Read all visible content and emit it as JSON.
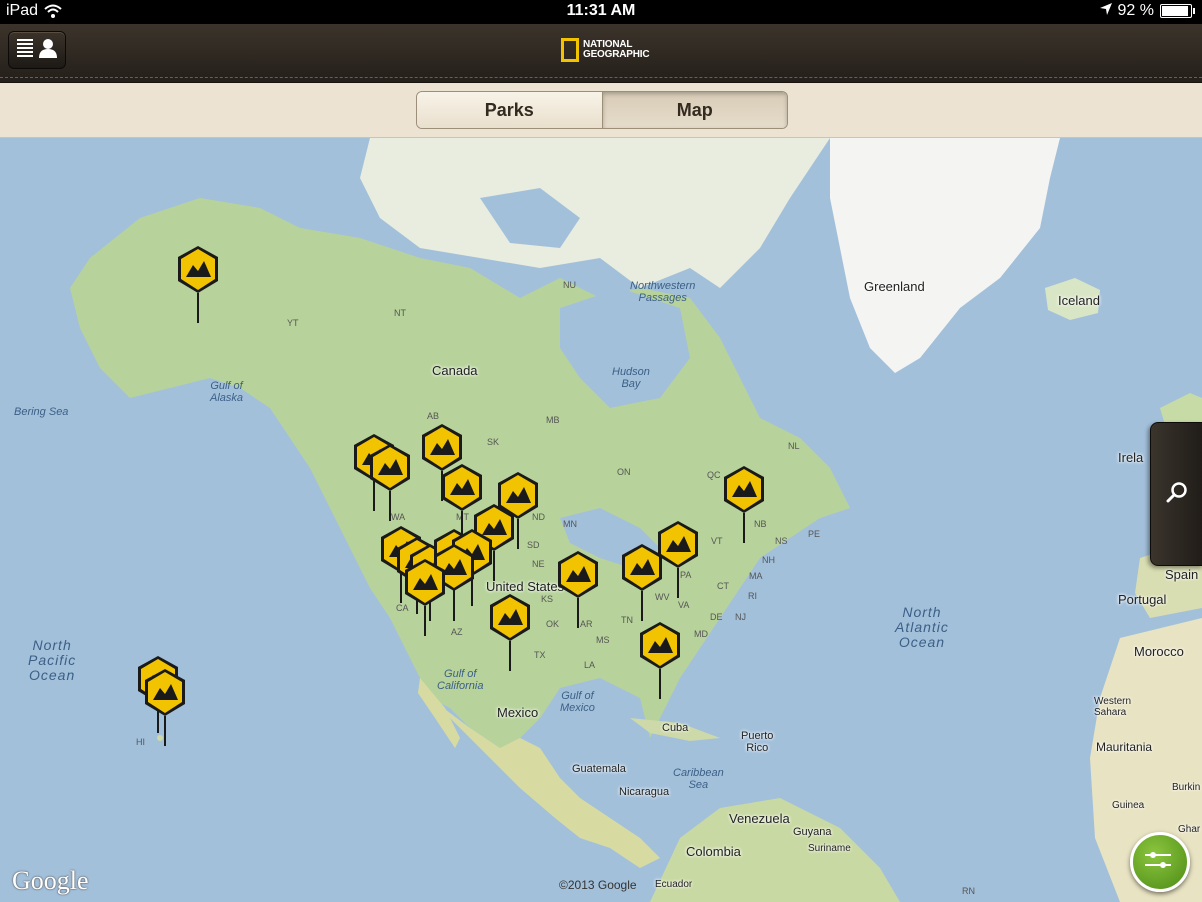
{
  "status_bar": {
    "device": "iPad",
    "time": "11:31 AM",
    "battery": "92 %",
    "battery_level": 0.92
  },
  "nav": {
    "menu_icon": "list-profile-icon",
    "logo_line1": "NATIONAL",
    "logo_line2": "GEOGRAPHIC"
  },
  "segments": {
    "parks": "Parks",
    "map": "Map",
    "selected": "Map"
  },
  "map": {
    "countries": {
      "canada": "Canada",
      "greenland": "Greenland",
      "iceland": "Iceland",
      "us": "United States",
      "mexico": "Mexico",
      "cuba": "Cuba",
      "puerto_rico": "Puerto\nRico",
      "guatemala": "Guatemala",
      "nicaragua": "Nicaragua",
      "venezuela": "Venezuela",
      "guyana": "Guyana",
      "suriname": "Suriname",
      "colombia": "Colombia",
      "ecuador": "Ecuador",
      "spain": "Spain",
      "portugal": "Portugal",
      "morocco": "Morocco",
      "western_sahara": "Western\nSahara",
      "mauritania": "Mauritania",
      "guinea": "Guinea",
      "burkina": "Burkin",
      "ireland": "Irela",
      "ghana": "Ghar"
    },
    "oceans": {
      "north_pacific": "North\nPacific\nOcean",
      "north_atlantic": "North\nAtlantic\nOcean"
    },
    "seas": {
      "bering": "Bering Sea",
      "gulf_alaska": "Gulf of\nAlaska",
      "hudson": "Hudson\nBay",
      "northwestern": "Northwestern\nPassages",
      "gulf_california": "Gulf of\nCalifornia",
      "gulf_mexico": "Gulf of\nMexico",
      "caribbean": "Caribbean\nSea"
    },
    "regions": {
      "nu": "NU",
      "nt": "NT",
      "yt": "YT",
      "ab": "AB",
      "sk": "SK",
      "mb": "MB",
      "on": "ON",
      "qc": "QC",
      "nl": "NL",
      "nb": "NB",
      "ns": "NS",
      "pe": "PE",
      "wa": "WA",
      "mt": "MT",
      "nd": "ND",
      "mn": "MN",
      "sd": "SD",
      "ne": "NE",
      "ks": "KS",
      "ok": "OK",
      "ar": "AR",
      "ms": "MS",
      "tn": "TN",
      "la": "LA",
      "tx": "TX",
      "az": "AZ",
      "ca": "CA",
      "vt": "VT",
      "nh": "NH",
      "ma": "MA",
      "ct": "CT",
      "ri": "RI",
      "nj": "NJ",
      "de": "DE",
      "md": "MD",
      "va": "VA",
      "wv": "WV",
      "pa": "PA",
      "hi": "HI",
      "rn": "RN"
    },
    "google_logo": "Google",
    "copyright": "©2013 Google"
  },
  "controls": {
    "search_icon": "search-icon",
    "filter_icon": "sliders-icon"
  },
  "colors": {
    "pin_yellow": "#f2c300",
    "pin_black": "#1a1a1a",
    "nav_dark": "#2c2620",
    "segment_bg": "#ece3d2",
    "water": "#a3c0db",
    "land": "#b8d4a0",
    "filter_green": "#5e9e1e"
  }
}
